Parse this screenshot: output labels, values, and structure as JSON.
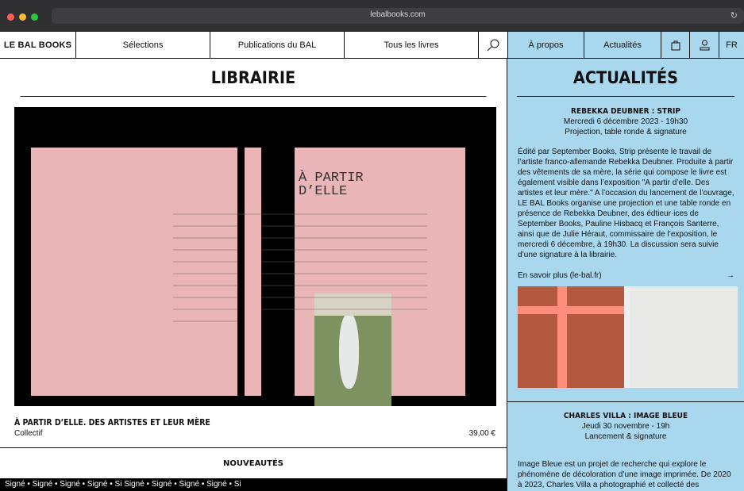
{
  "browser": {
    "url": "lebalbooks.com",
    "reload": "↻",
    "colors": [
      "#ff5f57",
      "#febc2e",
      "#28c840"
    ]
  },
  "nav": {
    "logo": "LE BAL BOOKS",
    "items": [
      "Sélections",
      "Publications du BAL",
      "Tous les livres"
    ],
    "search": "search-icon",
    "right": [
      "À propos",
      "Actualités"
    ],
    "lang": "FR"
  },
  "left": {
    "heading": "LIBRAIRIE",
    "product_title": "À PARTIR D’ELLE. DES ARTISTES ET LEUR MÈRE",
    "author": "Collectif",
    "price": "39,00 €",
    "book_title": "À PARTIR\nD’ELLE",
    "new_heading": "NOUVEAUTÉS",
    "ticker": "Signé  •  Signé  •  Signé  •  Signé  •  Si  Signé  •  Signé  •  Signé  •  Signé  •  Si"
  },
  "right": {
    "heading": "ACTUALITÉS",
    "event1": {
      "title": "REBEKKA DEUBNER : STRIP",
      "date": "Mercredi 6 décembre 2023 - 19h30",
      "type": "Projection, table ronde & signature",
      "body": "Édité par September Books, Strip présente le travail de l’artiste franco-allemande Rebekka Deubner. Produite à partir des vêtements de sa mère, la série qui compose le livre est également visible dans l’exposition \"A partir d’elle. Des artistes et leur mère.\" A l’occasion du lancement de l’ouvrage, LE BAL Books organise une projection et une table ronde en présence de Rebekka Deubner, des édtieur·ices de September Books, Pauline Hisbacq et François Santerre, ainsi que de Julie Héraut, commissaire de l’exposition, le mercredi 6 décembre, à 19h30. La discussion sera suivie d’une signature à la librairie.",
      "link": "En savoir plus (le-bal.fr)",
      "arrow": "→"
    },
    "event2": {
      "title": "CHARLES VILLA : IMAGE BLEUE",
      "date": "Jeudi 30 novembre - 19h",
      "type": "Lancement & signature",
      "body": "Image Bleue est un projet de recherche qui explore le phénomène de décoloration d’une image imprimée. De 2020 à 2023, Charles Villa a photographié et collecté des centaines d’images décolorées jusqu’au bleuissement, par l’exposition à"
    }
  }
}
